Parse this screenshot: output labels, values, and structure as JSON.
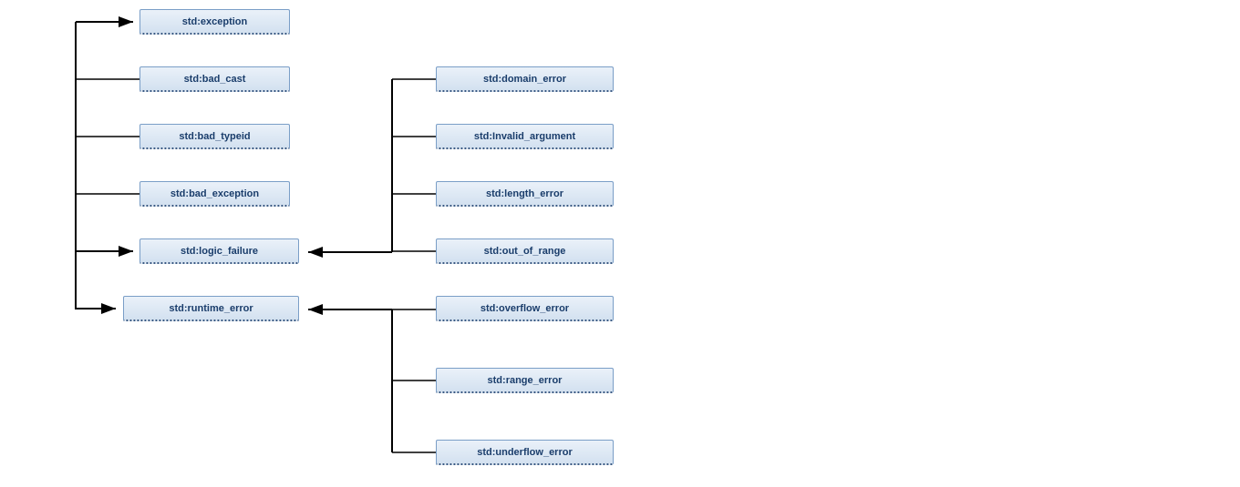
{
  "diagram": {
    "column1": [
      {
        "label": "std:exception"
      },
      {
        "label": "std:bad_cast"
      },
      {
        "label": "std:bad_typeid"
      },
      {
        "label": "std:bad_exception"
      },
      {
        "label": "std:logic_failure"
      },
      {
        "label": "std:runtime_error"
      }
    ],
    "group_logic": [
      {
        "label": "std:domain_error"
      },
      {
        "label": "std:Invalid_argument"
      },
      {
        "label": "std:length_error"
      },
      {
        "label": "std:out_of_range"
      }
    ],
    "group_runtime": [
      {
        "label": "std:overflow_error"
      },
      {
        "label": "std:range_error"
      },
      {
        "label": "std:underflow_error"
      }
    ]
  }
}
